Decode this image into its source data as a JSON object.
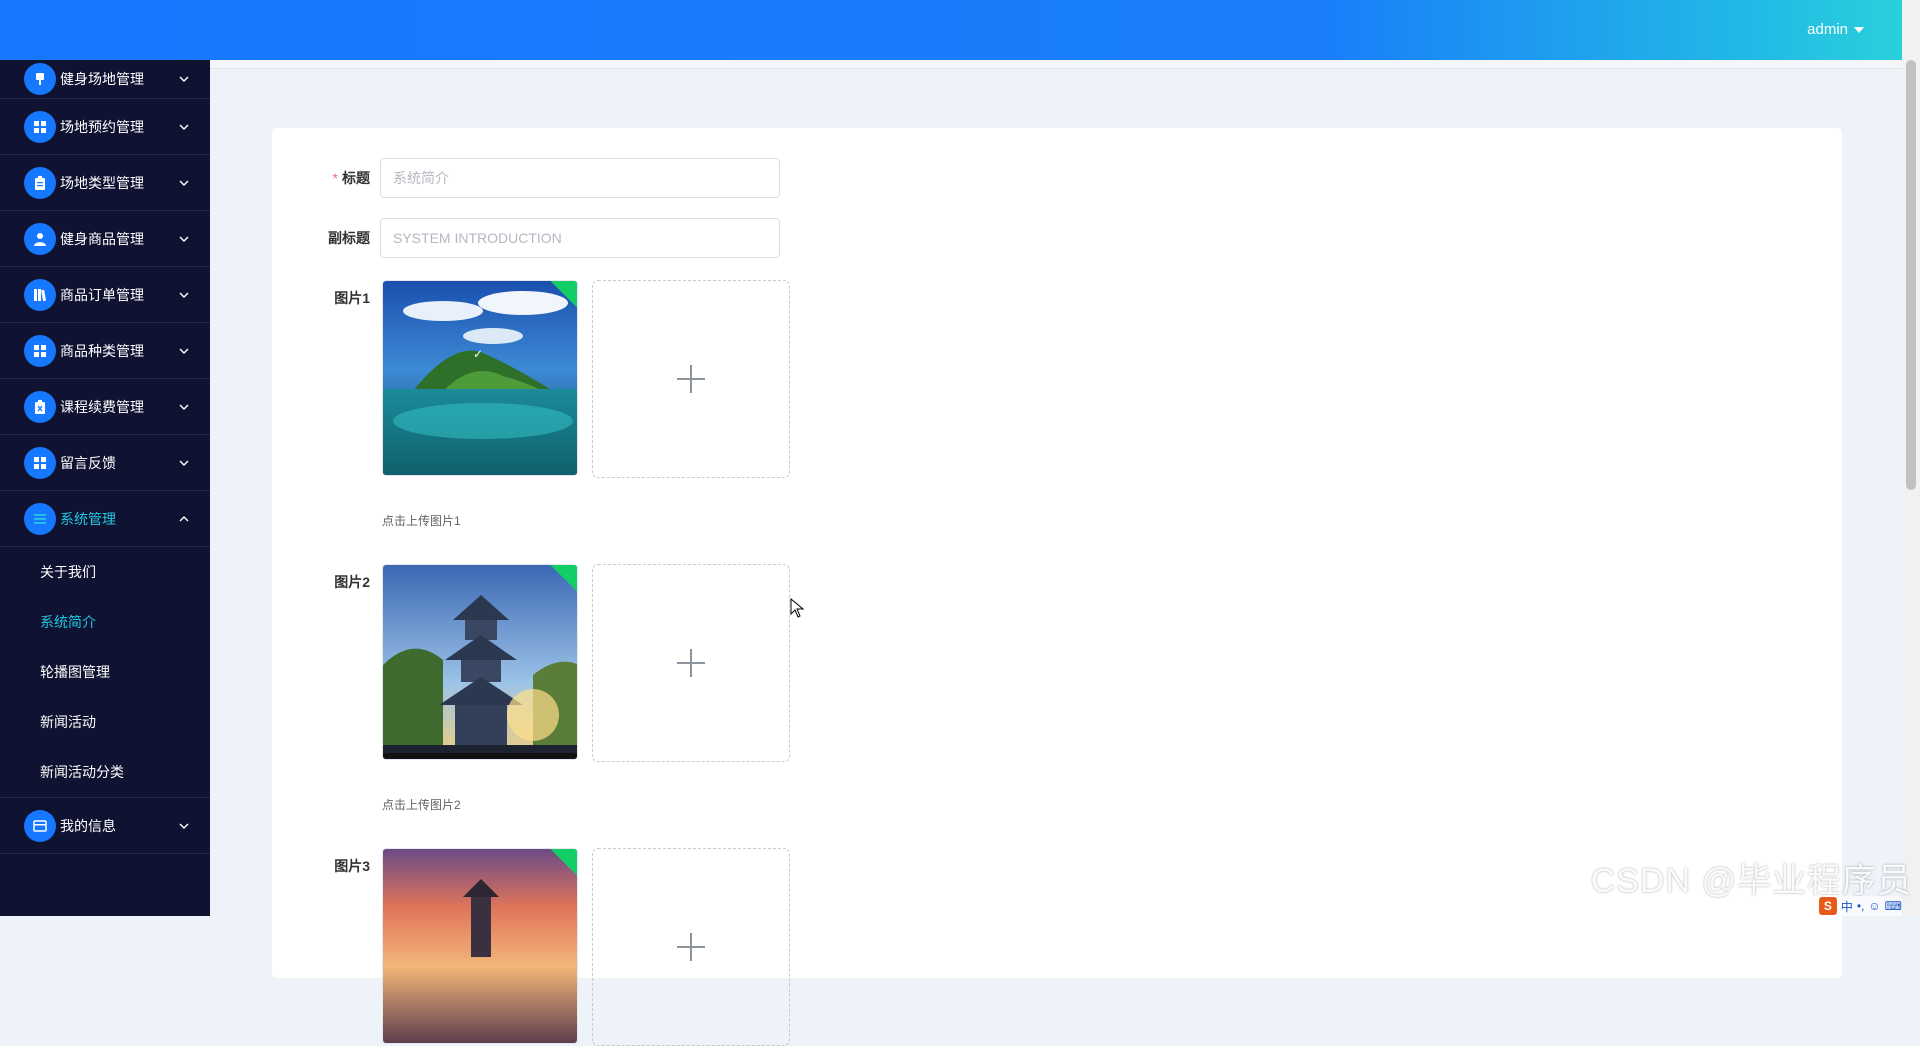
{
  "header": {
    "user": "admin"
  },
  "sidebar": {
    "items": [
      {
        "label": "健身场地管理",
        "icon": "chair-icon"
      },
      {
        "label": "场地预约管理",
        "icon": "grid-icon"
      },
      {
        "label": "场地类型管理",
        "icon": "clipboard-icon"
      },
      {
        "label": "健身商品管理",
        "icon": "user-icon"
      },
      {
        "label": "商品订单管理",
        "icon": "books-icon"
      },
      {
        "label": "商品种类管理",
        "icon": "grid-icon"
      },
      {
        "label": "课程续费管理",
        "icon": "clipboard-x-icon"
      },
      {
        "label": "留言反馈",
        "icon": "grid-icon"
      },
      {
        "label": "系统管理",
        "icon": "list-icon"
      },
      {
        "label": "我的信息",
        "icon": "card-icon"
      }
    ],
    "submenu": [
      "关于我们",
      "系统简介",
      "轮播图管理",
      "新闻活动",
      "新闻活动分类"
    ]
  },
  "form": {
    "title_label": "标题",
    "title_value": "系统简介",
    "subtitle_label": "副标题",
    "subtitle_value": "SYSTEM INTRODUCTION",
    "images": [
      {
        "label": "图片1",
        "tip": "点击上传图片1"
      },
      {
        "label": "图片2",
        "tip": "点击上传图片2"
      },
      {
        "label": "图片3",
        "tip": ""
      }
    ]
  },
  "watermark": "CSDN @毕业程序员",
  "ime": {
    "lang": "中",
    "punct": "•,"
  },
  "colors": {
    "accent": "#1677ff",
    "sidebar_bg": "#0f1230",
    "active": "#21c7e3",
    "success": "#13ce66"
  }
}
